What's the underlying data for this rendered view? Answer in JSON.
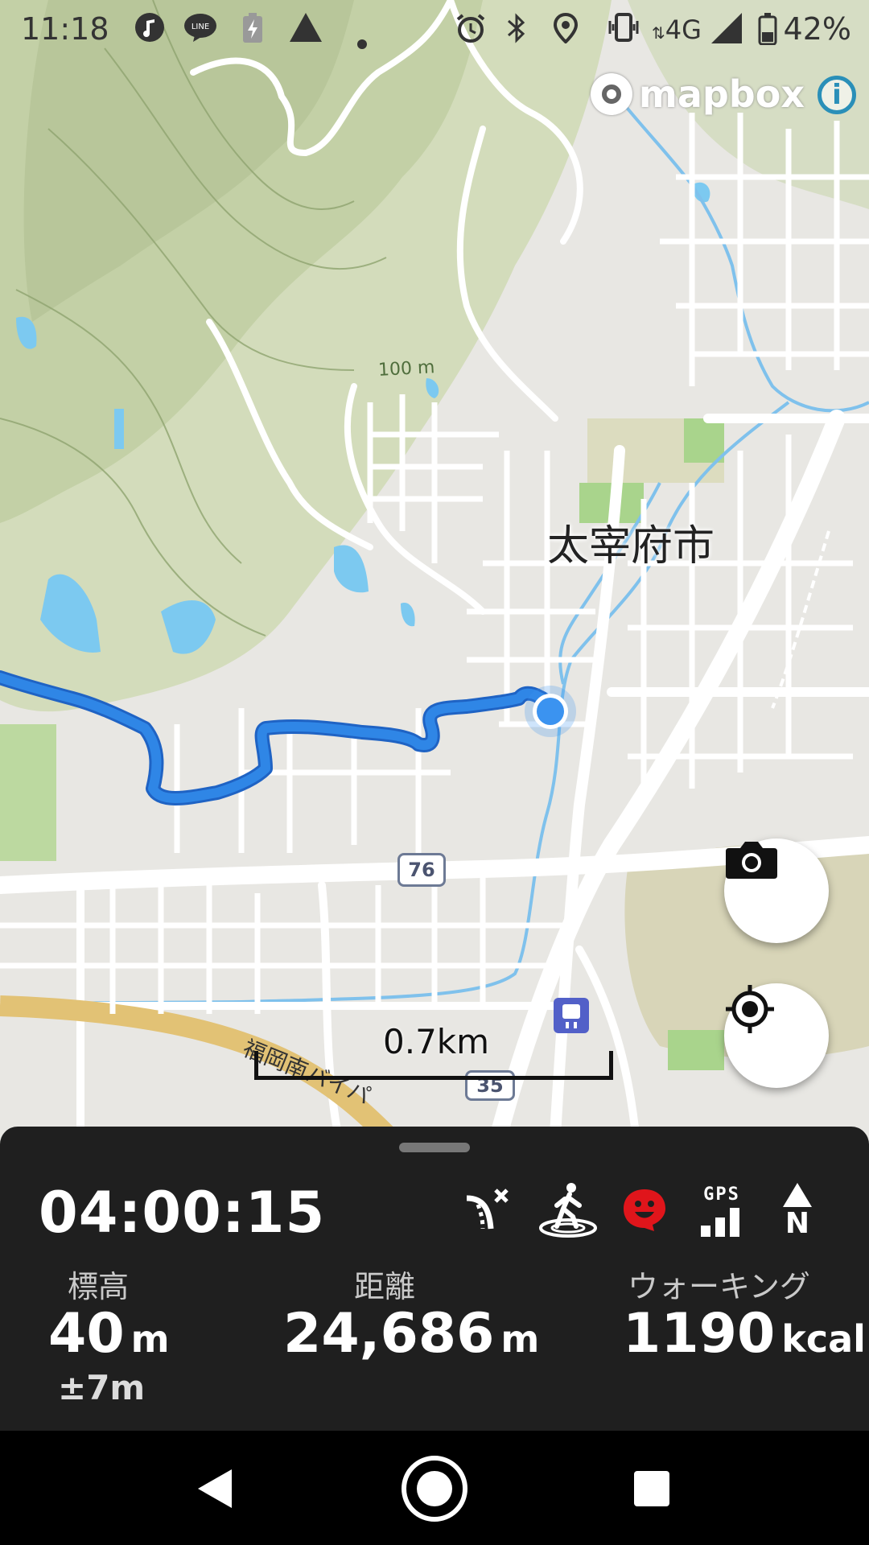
{
  "status_bar": {
    "time": "11:18",
    "network": "4G",
    "battery": "42%"
  },
  "map": {
    "attribution": "mapbox",
    "city_label": "太宰府市",
    "contour_label": "100 m",
    "route_numbers": [
      "76",
      "35"
    ],
    "road_name": "福岡南バイパ",
    "scale_label": "0.7km",
    "colors": {
      "route": "#1c70d6",
      "location_dot": "#3b93f0",
      "water": "#7cc9f0"
    }
  },
  "map_buttons": {
    "camera": "camera-icon",
    "locate": "locate-icon"
  },
  "panel": {
    "elapsed_time": "04:00:15",
    "status_icons": [
      "route-off-icon",
      "walking-icon",
      "smiley-icon",
      "gps-signal-icon",
      "north-arrow-icon"
    ],
    "gps_text": "GPS",
    "north_text": "N",
    "elevation": {
      "label": "標高",
      "value": "40",
      "unit": "m",
      "accuracy": "±7m"
    },
    "distance": {
      "label": "距離",
      "value": "24,686",
      "unit": "m"
    },
    "activity": {
      "label": "ウォーキング",
      "value": "1190",
      "unit": "kcal"
    }
  },
  "nav_bar": {
    "back": "back-icon",
    "home": "home-icon",
    "recents": "recents-icon"
  }
}
